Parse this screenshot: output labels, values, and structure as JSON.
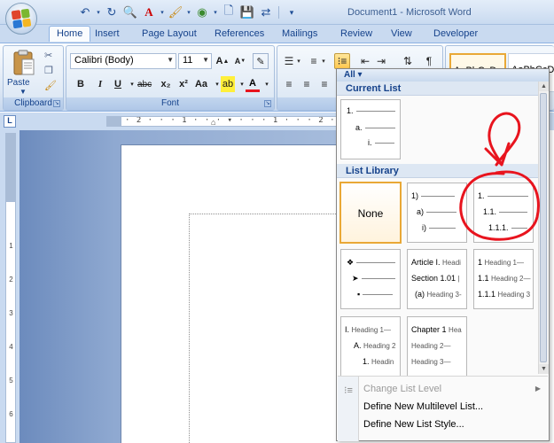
{
  "title": "Document1 - Microsoft Word",
  "tabs": [
    "Home",
    "Insert",
    "Page Layout",
    "References",
    "Mailings",
    "Review",
    "View",
    "Developer"
  ],
  "ribbon": {
    "clipboard": {
      "paste_label": "Paste",
      "group_label": "Clipboard"
    },
    "font": {
      "name": "Calibri (Body)",
      "size": "11",
      "group_label": "Font",
      "bold": "B",
      "italic": "I",
      "underline": "U",
      "strikethrough": "abc",
      "subscript": "x₂",
      "superscript": "x²",
      "change_case": "Aa",
      "font_color": "A"
    },
    "paragraph": {
      "group_label": "P"
    },
    "styles": [
      "AaBbCcDc",
      "AaBbCcDc"
    ]
  },
  "dropdown": {
    "filter": "All",
    "current_list_heading": "Current List",
    "current_list": [
      "1.",
      "a.",
      "i."
    ],
    "list_library_heading": "List Library",
    "tiles": {
      "none": "None",
      "t2": [
        "1)",
        "a)",
        "i)"
      ],
      "t3": [
        "1.",
        "1.1.",
        "1.1.1."
      ],
      "t5": [
        "Article I.",
        "Section 1.01",
        "(a)"
      ],
      "t5_suffix": [
        "Headi",
        "",
        "Heading 3-"
      ],
      "t6_num": [
        "1",
        "1.1",
        "1.1.1"
      ],
      "t6_head": [
        "Heading 1—",
        "Heading 2—",
        "Heading 3"
      ],
      "t7_num": [
        "I.",
        "A.",
        "1."
      ],
      "t7_head": [
        "Heading 1—",
        "Heading 2",
        "Headin"
      ],
      "t8_num": [
        "Chapter 1",
        "",
        ""
      ],
      "t8_head": [
        "Hea",
        "Heading 2—",
        "Heading 3—"
      ]
    },
    "menu": {
      "change_level": "Change List Level",
      "define_multilevel": "Define New Multilevel List...",
      "define_style": "Define New List Style..."
    }
  },
  "ruler": {
    "horizontal": "· 2 · · · 1 · · · ▾ · · · 1 · · · 2 · · · 3 · ·",
    "vertical": [
      "2",
      "1",
      "1",
      "2",
      "3",
      "4",
      "5",
      "6"
    ],
    "tab_selector": "L"
  },
  "colors": {
    "accent": "#e9a836",
    "ribbon": "#dbe6f4",
    "annotation": "#e8141e"
  }
}
